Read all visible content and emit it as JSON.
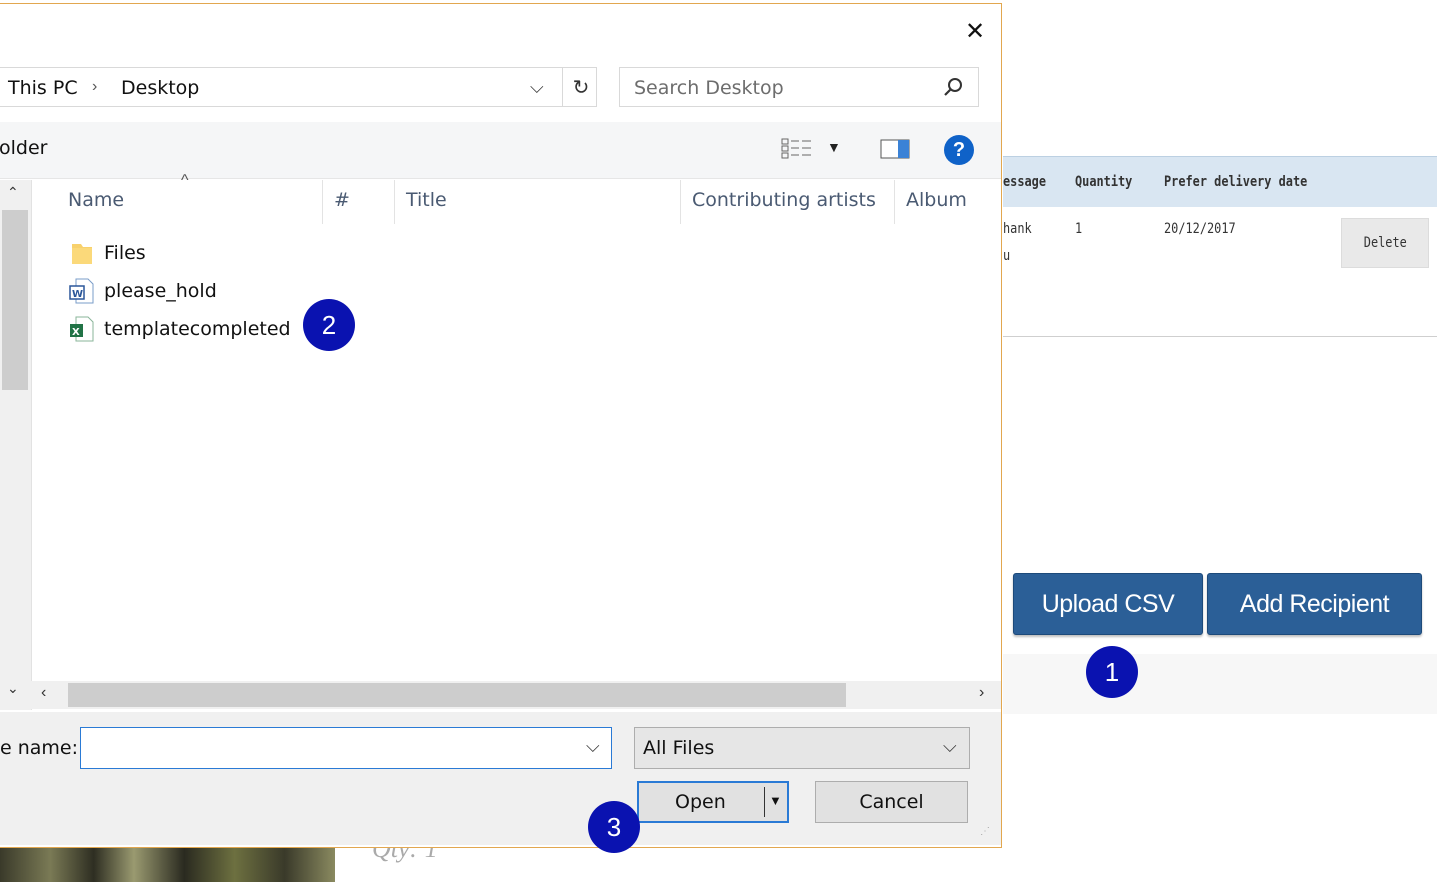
{
  "background": {
    "table": {
      "headers": [
        "essage",
        "Quantity",
        "Prefer delivery date"
      ],
      "row": {
        "message_line1": "hank",
        "message_line2": "u",
        "quantity": "1",
        "date": "20/12/2017",
        "delete_label": "Delete"
      }
    },
    "upload_label": "Upload CSV",
    "add_recipient_label": "Add Recipient",
    "qty_text": "Qty: 1"
  },
  "markers": [
    "1",
    "2",
    "3"
  ],
  "dialog": {
    "close_icon": "close-icon",
    "breadcrumb": [
      "This PC",
      "Desktop"
    ],
    "search_placeholder": "Search Desktop",
    "toolbar_label": "older",
    "columns": [
      "Name",
      "#",
      "Title",
      "Contributing artists",
      "Album"
    ],
    "files": [
      {
        "name": "Files",
        "icon": "folder-icon"
      },
      {
        "name": "please_hold",
        "icon": "word-document-icon"
      },
      {
        "name": "templatecompleted",
        "icon": "excel-file-icon"
      }
    ],
    "file_name_label": "e name:",
    "file_name_value": "",
    "filter_value": "All Files",
    "open_label": "Open",
    "cancel_label": "Cancel"
  },
  "colors": {
    "accent_blue": "#2b5f97",
    "marker_blue": "#0a12b0",
    "dialog_border": "#e2a74f",
    "focus_blue": "#2a7ad5"
  }
}
